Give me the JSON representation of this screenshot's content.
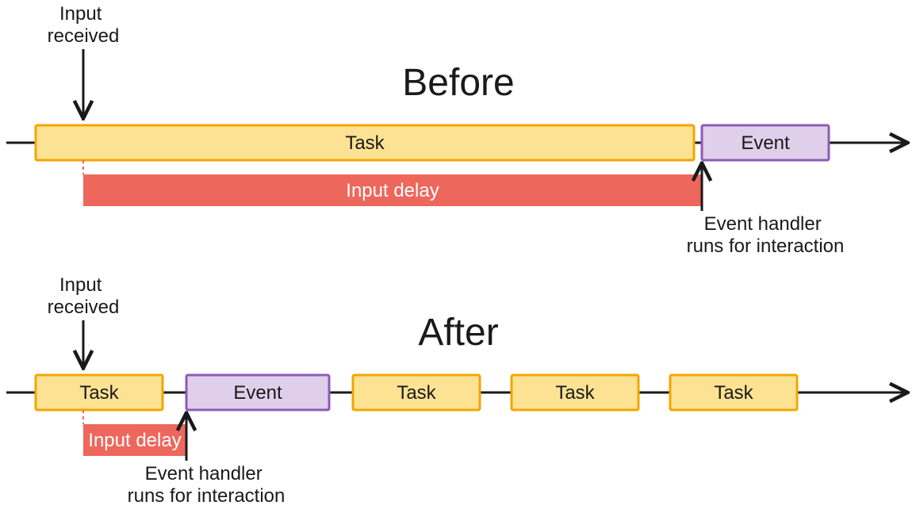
{
  "before": {
    "heading": "Before",
    "input_received": "Input\nreceived",
    "task": "Task",
    "event": "Event",
    "input_delay": "Input delay",
    "handler_line1": "Event handler",
    "handler_line2": "runs for interaction"
  },
  "after": {
    "heading": "After",
    "input_received": "Input\nreceived",
    "event": "Event",
    "tasks": [
      "Task",
      "Task",
      "Task",
      "Task"
    ],
    "input_delay": "Input delay",
    "handler_line1": "Event handler",
    "handler_line2": "runs for interaction"
  }
}
